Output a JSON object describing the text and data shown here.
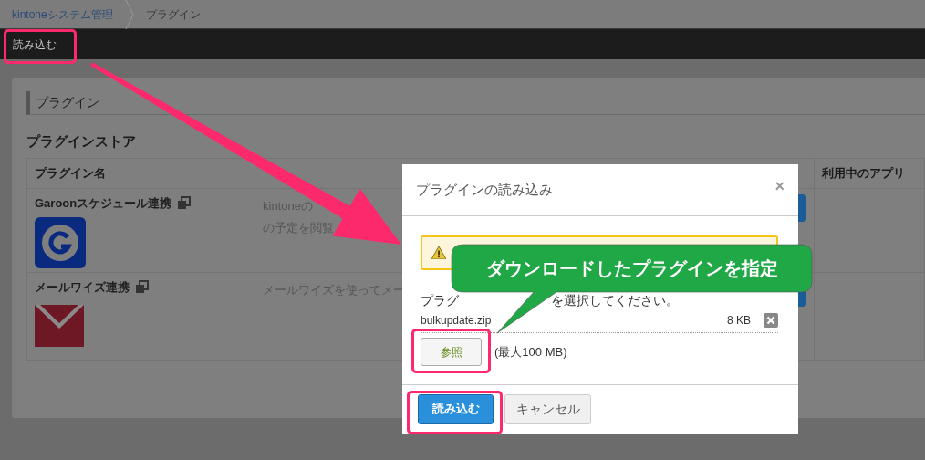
{
  "breadcrumb": [
    {
      "label": "kintoneシステム管理",
      "kind": "link"
    },
    {
      "label": "プラグイン",
      "kind": "current"
    }
  ],
  "toolbar": {
    "button": "読み込む"
  },
  "panel": {
    "title": "プラグイン",
    "section_title": "プラグインストア",
    "table": {
      "columns": [
        "プラグイン名",
        "利用中のアプリ"
      ],
      "rows": [
        {
          "name": "Garoonスケジュール連携",
          "kind": "garoon",
          "description": [
            "kintoneの",
            "の予定を閲覧"
          ]
        },
        {
          "name": "メールワイズ連携",
          "kind": "mail",
          "description": [
            "メールワイズを使ってメー"
          ]
        }
      ]
    }
  },
  "dialog": {
    "title": "プラグインの読み込み",
    "close": "×",
    "prompt": [
      "プラグ",
      "を選択してください。"
    ],
    "file": {
      "name": "bulkupdate.zip",
      "size": "8 KB"
    },
    "browse_button": "参照",
    "limit": "(最大100 MB)",
    "buttons": [
      {
        "label": "読み込む",
        "kind": "primary"
      },
      {
        "label": "キャンセル",
        "kind": "secondary"
      }
    ]
  },
  "callout": "ダウンロードしたプラグインを指定"
}
